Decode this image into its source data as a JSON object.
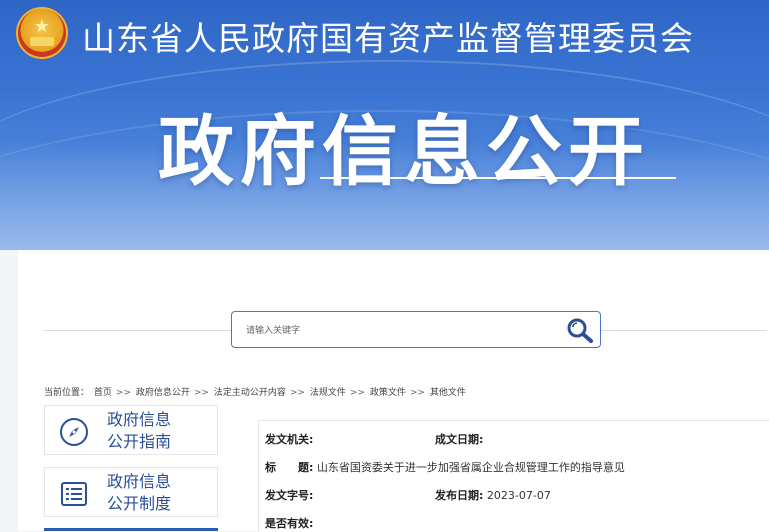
{
  "header": {
    "org_name": "山东省人民政府国有资产监督管理委员会",
    "section_title": "政府信息公开"
  },
  "search": {
    "placeholder": "请输入关键字"
  },
  "breadcrumb": {
    "label": "当前位置：",
    "items": [
      "首页",
      "政府信息公开",
      "法定主动公开内容",
      "法规文件",
      "政策文件",
      "其他文件"
    ],
    "separator": ">>"
  },
  "sidebar": {
    "items": [
      {
        "line1": "政府信息",
        "line2": "公开指南",
        "icon": "compass-icon"
      },
      {
        "line1": "政府信息",
        "line2": "公开制度",
        "icon": "list-document-icon"
      }
    ]
  },
  "meta": {
    "issuer_label": "发文机关:",
    "issuer_value": "",
    "created_label": "成文日期:",
    "created_value": "",
    "title_label": "标　　题:",
    "title_value": "山东省国资委关于进一步加强省属企业合规管理工作的指导意见",
    "docno_label": "发文字号:",
    "docno_value": "",
    "published_label": "发布日期:",
    "published_value": "2023-07-07",
    "valid_label": "是否有效:",
    "valid_value": ""
  },
  "colors": {
    "banner_blue": "#3a74d2",
    "link_blue": "#2a4f9a",
    "search_border": "#4a77c4"
  }
}
